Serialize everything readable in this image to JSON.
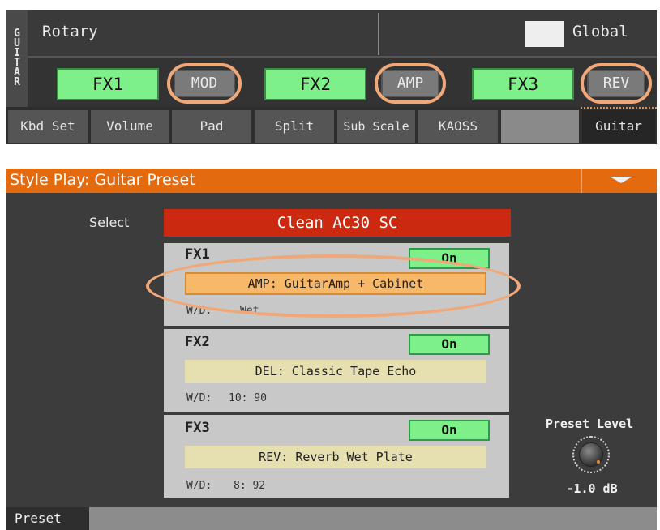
{
  "top": {
    "vertical_label": [
      "G",
      "U",
      "I",
      "T",
      "A",
      "R"
    ],
    "style_name": "Rotary",
    "global_label": "Global",
    "fx_buttons": [
      {
        "label": "FX1",
        "type": "MOD"
      },
      {
        "label": "FX2",
        "type": "AMP"
      },
      {
        "label": "FX3",
        "type": "REV"
      }
    ],
    "tabs": [
      {
        "label": "Kbd Set"
      },
      {
        "label": "Volume"
      },
      {
        "label": "Pad"
      },
      {
        "label": "Split"
      },
      {
        "label": "Sub Scale"
      },
      {
        "label": "KAOSS"
      },
      {
        "label": ""
      },
      {
        "label": "Guitar"
      }
    ],
    "active_tab": "Guitar"
  },
  "page": {
    "title": "Style Play: Guitar Preset",
    "select_label": "Select",
    "preset_name": "Clean AC30 SC",
    "fx": [
      {
        "name": "FX1",
        "state": "On",
        "type": "AMP: GuitarAmp + Cabinet",
        "wd_label": "W/D:",
        "wd_value": "Wet"
      },
      {
        "name": "FX2",
        "state": "On",
        "type": "DEL: Classic Tape Echo",
        "wd_label": "W/D:",
        "wd_value": "10: 90"
      },
      {
        "name": "FX3",
        "state": "On",
        "type": "REV: Reverb Wet Plate",
        "wd_label": "W/D:",
        "wd_value": "8: 92"
      }
    ],
    "preset_level_label": "Preset Level",
    "preset_level_value": "-1.0 dB",
    "footer_tab": "Preset"
  },
  "colors": {
    "title_bar": "#e46a10",
    "preset_select": "#cc2a10",
    "fx_on": "#7ef08a",
    "highlight_ring": "#f0a878"
  }
}
